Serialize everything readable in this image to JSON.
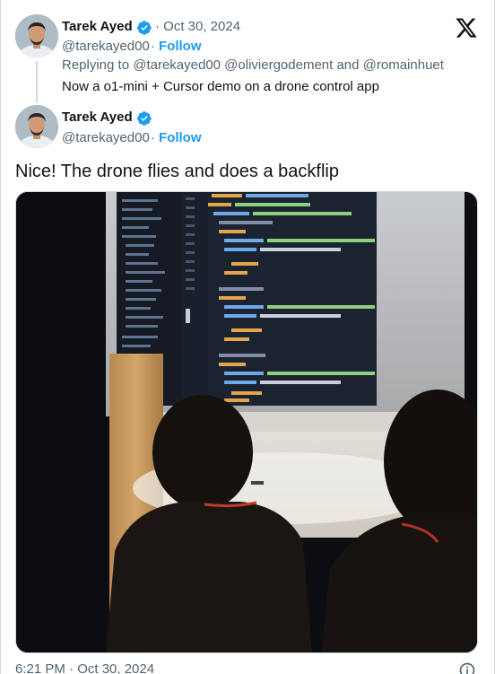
{
  "reply_tweet": {
    "author_name": "Tarek Ayed",
    "date": "· Oct 30, 2024",
    "handle": "@tarekayed00",
    "separator": "·",
    "follow_label": "Follow",
    "replying_prefix": "Replying to",
    "mentions": "@tarekayed00 @oliviergodement and @romainhuet",
    "text": "Now a o1-mini + Cursor demo on a drone control app"
  },
  "main_tweet": {
    "author_name": "Tarek Ayed",
    "handle": "@tarekayed00",
    "separator": "·",
    "follow_label": "Follow",
    "text": "Nice! The drone flies and does a backflip",
    "timestamp": "6:21 PM · Oct 30, 2024"
  },
  "media": {
    "kind": "video-frame",
    "code_lines": [
      "<div className=\"text-xxl\">{\"flying\"}</div>",
      "<div className=\"font-semibold\">Position</div>",
      "<div className=\"flex flex-col items-center space-y-4\">",
      "{/* Up Button */}",
      "<button",
      "className=\"btn-command absolute top-0 left-1/2 transform -translate\"",
      "onClick={() => sendCommand(\"up 20\")}",
      ">",
      "<ArUp />",
      "</button>",
      "{/* Left Button */}",
      "<button",
      "className=\"btn-command absolute left-0 top-1/2 transform -trans\"",
      "onClick={() => sendCommand(\"left 20\")}",
      ">",
      "<ArLeft />",
      "</button>",
      "{/* Right Button */}",
      "<button",
      "className=\"btn-command absolute right-0 top-1/2 transform -tra\"",
      "onClick={() => sendCommand(\"right 20\")}",
      ">",
      "<ArRight />",
      "</button>"
    ]
  },
  "icons": {
    "verified": "verified-badge-icon",
    "x_logo": "x-logo-icon",
    "info": "info-icon"
  },
  "colors": {
    "link_blue": "#1d9bf0",
    "secondary_text": "#536471",
    "primary_text": "#0f1419",
    "border": "#cfd9de"
  }
}
